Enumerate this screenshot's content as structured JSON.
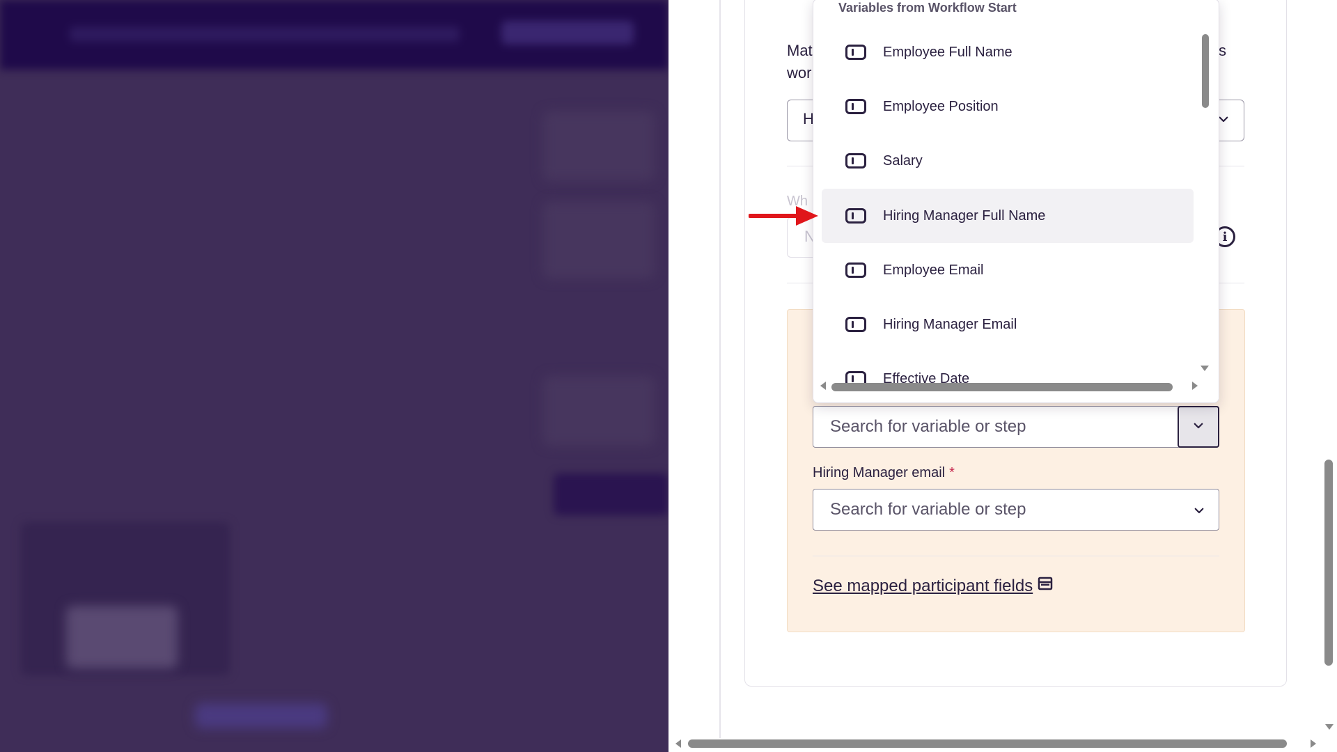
{
  "dropdown": {
    "header": "Variables from Workflow Start",
    "items": [
      {
        "label": "Employee Full Name",
        "icon": "variable-icon"
      },
      {
        "label": "Employee Position",
        "icon": "variable-icon"
      },
      {
        "label": "Salary",
        "icon": "variable-icon"
      },
      {
        "label": "Hiring Manager Full Name",
        "icon": "variable-icon",
        "highlighted": true
      },
      {
        "label": "Employee Email",
        "icon": "variable-icon"
      },
      {
        "label": "Hiring Manager Email",
        "icon": "variable-icon"
      },
      {
        "label": "Effective Date",
        "icon": "variable-icon"
      }
    ]
  },
  "partial": {
    "line1_left": "Mat",
    "line1_right": "s",
    "line2_left": "wor",
    "select_left": "H",
    "faded_label": "Wh",
    "faded_input": "N"
  },
  "fields": {
    "first_search_placeholder": "Search for variable or step",
    "hiring_manager_email_label": "Hiring Manager email",
    "required_mark": "*",
    "hiring_manager_email_placeholder": "Search for variable or step"
  },
  "link": {
    "text": "See mapped participant fields"
  },
  "colors": {
    "accent_dark": "#2b2140",
    "section_bg": "#fdf0e3",
    "required": "#c4224a",
    "arrow": "#e0161b",
    "backdrop": "#3f2d58"
  }
}
